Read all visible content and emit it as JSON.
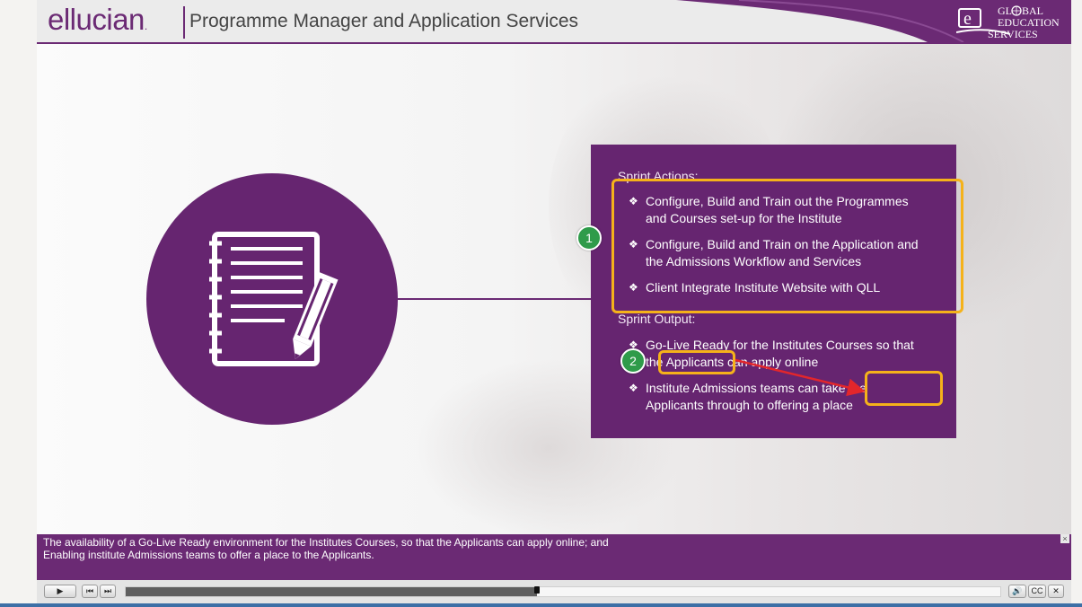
{
  "header": {
    "logo_text": "ellucian",
    "logo_mark": ".",
    "title": "Programme Manager and Application Services",
    "partner_logo_letter": "e",
    "partner_logo_lines": [
      "GL",
      "BAL",
      "EDUCATION",
      "SERVICES"
    ]
  },
  "slide": {
    "icon": "notepad-pencil-icon",
    "sprint_actions_heading": "Sprint Actions:",
    "sprint_actions": [
      "Configure, Build and Train out the Programmes and Courses set-up for the Institute",
      "Configure, Build and Train on the Application and the Admissions Workflow and Services",
      "Client Integrate Institute Website with QLL"
    ],
    "sprint_output_heading": "Sprint Output:",
    "sprint_output": [
      "Go-Live Ready for the Institutes Courses so that the Applicants can apply online",
      "Institute Admissions teams can take the Applicants through to offering a place"
    ],
    "bullet_glyph": "❖",
    "markers": [
      "1",
      "2"
    ]
  },
  "caption": {
    "text": "The availability of a Go-Live Ready environment for the Institutes Courses, so that the Applicants can apply online; and\nEnabling institute Admissions teams to offer a place to the Applicants.",
    "close_label": "×"
  },
  "player": {
    "play_label": "▶",
    "prev_label": "⏮",
    "next_label": "⏭",
    "progress": 0.47,
    "volume_label": "🔊",
    "cc_label": "CC",
    "close_label": "✕"
  },
  "colors": {
    "brand_purple": "#6b2a74",
    "highlight": "#f5b21a",
    "marker_green": "#2f9b4a",
    "arrow_red": "#e3262b"
  }
}
